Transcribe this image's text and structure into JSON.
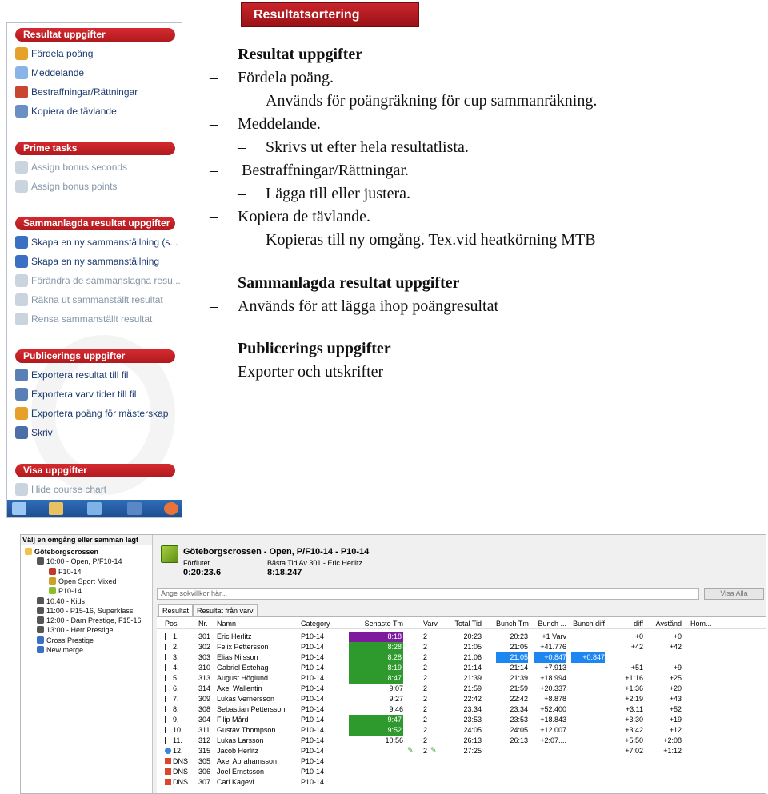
{
  "banner": {
    "title": "Resultatsortering"
  },
  "panel": {
    "sections": [
      {
        "title": "Resultat uppgifter",
        "items": [
          {
            "label": "Fördela poäng",
            "icon": "points-icon",
            "disabled": false
          },
          {
            "label": "Meddelande",
            "icon": "message-icon",
            "disabled": false
          },
          {
            "label": "Bestraffningar/Rättningar",
            "icon": "penalty-icon",
            "disabled": false
          },
          {
            "label": "Kopiera de tävlande",
            "icon": "copy-icon",
            "disabled": false
          }
        ]
      },
      {
        "title": "Prime tasks",
        "items": [
          {
            "label": "Assign bonus seconds",
            "icon": "bonus-seconds-icon",
            "disabled": true
          },
          {
            "label": "Assign bonus points",
            "icon": "bonus-points-icon",
            "disabled": true
          }
        ]
      },
      {
        "title": "Sammanlagda resultat uppgifter",
        "items": [
          {
            "label": "Skapa en ny sammanställning (s...",
            "icon": "new-summary-icon",
            "disabled": false
          },
          {
            "label": "Skapa en ny sammanställning",
            "icon": "new-summary-icon",
            "disabled": false
          },
          {
            "label": "Förändra de sammanslagna resu...",
            "icon": "edit-summary-icon",
            "disabled": true
          },
          {
            "label": "Räkna ut sammanställt resultat",
            "icon": "calculate-icon",
            "disabled": true
          },
          {
            "label": "Rensa sammanställt resultat",
            "icon": "clear-icon",
            "disabled": true
          }
        ]
      },
      {
        "title": "Publicerings uppgifter",
        "items": [
          {
            "label": "Exportera resultat till fil",
            "icon": "export-icon",
            "disabled": false
          },
          {
            "label": "Exportera varv tider till fil",
            "icon": "export-icon",
            "disabled": false
          },
          {
            "label": "Exportera poäng för mästerskap",
            "icon": "export-points-icon",
            "disabled": false
          },
          {
            "label": "Skriv",
            "icon": "print-icon",
            "disabled": false
          }
        ]
      },
      {
        "title": "Visa uppgifter",
        "items": [
          {
            "label": "Hide course chart",
            "icon": "chart-icon",
            "disabled": true
          }
        ]
      }
    ]
  },
  "notes": [
    {
      "text": "Resultat uppgifter",
      "kind": "heading",
      "dash": ""
    },
    {
      "text": "Fördela poäng.",
      "kind": "item",
      "dash": "–"
    },
    {
      "text": "Används för poängräkning för cup sammanräkning.",
      "kind": "sub",
      "dash": "–"
    },
    {
      "text": "Meddelande.",
      "kind": "item",
      "dash": "–"
    },
    {
      "text": "Skrivs ut efter hela resultatlista.",
      "kind": "sub",
      "dash": "–"
    },
    {
      "text": " Bestraffningar/Rättningar.",
      "kind": "item",
      "dash": "–"
    },
    {
      "text": "Lägga till eller justera.",
      "kind": "sub",
      "dash": "–"
    },
    {
      "text": "Kopiera de tävlande.",
      "kind": "item",
      "dash": "–"
    },
    {
      "text": "Kopieras till ny omgång. Tex.vid heatkörning MTB",
      "kind": "sub",
      "dash": "–"
    },
    {
      "text": "Sammanlagda resultat uppgifter",
      "kind": "heading",
      "dash": ""
    },
    {
      "text": "Används för att lägga ihop poängresultat",
      "kind": "item",
      "dash": "–"
    },
    {
      "text": "Publicerings uppgifter",
      "kind": "heading",
      "dash": ""
    },
    {
      "text": "Exporter och utskrifter",
      "kind": "item",
      "dash": "–"
    }
  ],
  "app": {
    "tree_title": "Välj en omgång eller samman lagt",
    "tree": [
      {
        "label": "Göteborgscrossen",
        "bold": true,
        "color": "#f0c24a"
      },
      {
        "label": "10:00 - Open, P/F10-14",
        "bold": false,
        "color": "#555555"
      },
      {
        "label": "F10-14",
        "bold": false,
        "color": "#c0392b"
      },
      {
        "label": "Open Sport Mixed",
        "bold": false,
        "color": "#c9a227"
      },
      {
        "label": "P10-14",
        "bold": false,
        "color": "#8bbf2a"
      },
      {
        "label": "10:40 - Kids",
        "bold": false,
        "color": "#555555"
      },
      {
        "label": "11:00 - P15-16, Superklass",
        "bold": false,
        "color": "#555555"
      },
      {
        "label": "12:00 - Dam Prestige, F15-16",
        "bold": false,
        "color": "#555555"
      },
      {
        "label": "13:00 - Herr Prestige",
        "bold": false,
        "color": "#555555"
      },
      {
        "label": "Cross Prestige",
        "bold": false,
        "color": "#3a6fc4"
      },
      {
        "label": "New merge",
        "bold": false,
        "color": "#3a6fc4"
      }
    ],
    "race_title": "Göteborgscrossen - Open, P/F10-14 - P10-14",
    "elapsed_label": "Förflutet",
    "elapsed_value": "0:20:23.6",
    "best_label": "Bästa Tid Av 301 - Eric Herlitz",
    "best_value": "8:18.247",
    "search_placeholder": "Ange sokvillkor här...",
    "show_all": "Visa Alla",
    "tabs": [
      "Resultat",
      "Resultat från varv"
    ],
    "columns": [
      "Pos",
      "Nr.",
      "Namn",
      "Category",
      "Senaste Tm",
      "Varv",
      "Total Tid",
      "Bunch Tm",
      "Bunch ...",
      "Bunch diff",
      "diff",
      "Avstånd",
      "Hom..."
    ],
    "rows": [
      {
        "pos": "1.",
        "nr": "301",
        "name": "Eric Herlitz",
        "cat": "P10-14",
        "last": "8:18",
        "laps": "2",
        "total": "20:23",
        "btm": "20:23",
        "bunch": "+1 Varv",
        "bdiff": "",
        "diff": "+0",
        "dist": "+0",
        "status": "flag",
        "lastColor": "#7d1a9e",
        "btmHighlight": false
      },
      {
        "pos": "2.",
        "nr": "302",
        "name": "Felix Pettersson",
        "cat": "P10-14",
        "last": "8:28",
        "laps": "2",
        "total": "21:05",
        "btm": "21:05",
        "bunch": "+41.776",
        "bdiff": "",
        "diff": "+42",
        "dist": "+42",
        "status": "flag",
        "lastColor": "#2e9a2e",
        "btmHighlight": false
      },
      {
        "pos": "3.",
        "nr": "303",
        "name": "Elias Nilsson",
        "cat": "P10-14",
        "last": "8:28",
        "laps": "2",
        "total": "21:06",
        "btm": "21:05",
        "bunch": "+0.847",
        "bdiff": "+0.847",
        "diff": "",
        "dist": "",
        "status": "flag",
        "lastColor": "#2e9a2e",
        "btmHighlight": true
      },
      {
        "pos": "4.",
        "nr": "310",
        "name": "Gabriel Estehag",
        "cat": "P10-14",
        "last": "8:19",
        "laps": "2",
        "total": "21:14",
        "btm": "21:14",
        "bunch": "+7.913",
        "bdiff": "",
        "diff": "+51",
        "dist": "+9",
        "status": "flag",
        "lastColor": "#2e9a2e",
        "btmHighlight": false
      },
      {
        "pos": "5.",
        "nr": "313",
        "name": "August Höglund",
        "cat": "P10-14",
        "last": "8:47",
        "laps": "2",
        "total": "21:39",
        "btm": "21:39",
        "bunch": "+18.994",
        "bdiff": "",
        "diff": "+1:16",
        "dist": "+25",
        "status": "flag",
        "lastColor": "#2e9a2e",
        "btmHighlight": false
      },
      {
        "pos": "6.",
        "nr": "314",
        "name": "Axel Wallentin",
        "cat": "P10-14",
        "last": "9:07",
        "laps": "2",
        "total": "21:59",
        "btm": "21:59",
        "bunch": "+20.337",
        "bdiff": "",
        "diff": "+1:36",
        "dist": "+20",
        "status": "flag",
        "lastColor": "",
        "btmHighlight": false
      },
      {
        "pos": "7.",
        "nr": "309",
        "name": "Lukas Vernersson",
        "cat": "P10-14",
        "last": "9:27",
        "laps": "2",
        "total": "22:42",
        "btm": "22:42",
        "bunch": "+8.878",
        "bdiff": "",
        "diff": "+2:19",
        "dist": "+43",
        "status": "flag",
        "lastColor": "",
        "btmHighlight": false
      },
      {
        "pos": "8.",
        "nr": "308",
        "name": "Sebastian Pettersson",
        "cat": "P10-14",
        "last": "9:46",
        "laps": "2",
        "total": "23:34",
        "btm": "23:34",
        "bunch": "+52.400",
        "bdiff": "",
        "diff": "+3:11",
        "dist": "+52",
        "status": "flag",
        "lastColor": "",
        "btmHighlight": false
      },
      {
        "pos": "9.",
        "nr": "304",
        "name": "Filip Mård",
        "cat": "P10-14",
        "last": "9:47",
        "laps": "2",
        "total": "23:53",
        "btm": "23:53",
        "bunch": "+18.843",
        "bdiff": "",
        "diff": "+3:30",
        "dist": "+19",
        "status": "flag",
        "lastColor": "#2e9a2e",
        "btmHighlight": false
      },
      {
        "pos": "10.",
        "nr": "311",
        "name": "Gustav Thompson",
        "cat": "P10-14",
        "last": "9:52",
        "laps": "2",
        "total": "24:05",
        "btm": "24:05",
        "bunch": "+12.007",
        "bdiff": "",
        "diff": "+3:42",
        "dist": "+12",
        "status": "flag",
        "lastColor": "#2e9a2e",
        "btmHighlight": false
      },
      {
        "pos": "11.",
        "nr": "312",
        "name": "Lukas Larsson",
        "cat": "P10-14",
        "last": "10:56",
        "laps": "2",
        "total": "26:13",
        "btm": "26:13",
        "bunch": "+2:07....",
        "bdiff": "",
        "diff": "+5:50",
        "dist": "+2:08",
        "status": "flag",
        "lastColor": "",
        "btmHighlight": false
      },
      {
        "pos": "12.",
        "nr": "315",
        "name": "Jacob Herlitz",
        "cat": "P10-14",
        "last": "",
        "laps": "2",
        "total": "27:25",
        "btm": "",
        "bunch": "",
        "bdiff": "",
        "diff": "+7:02",
        "dist": "+1:12",
        "status": "dot",
        "lastColor": "",
        "btmHighlight": false
      },
      {
        "pos": "DNS",
        "nr": "305",
        "name": "Axel Abrahamsson",
        "cat": "P10-14",
        "last": "",
        "laps": "",
        "total": "",
        "btm": "",
        "bunch": "",
        "bdiff": "",
        "diff": "",
        "dist": "",
        "status": "dns",
        "lastColor": "",
        "btmHighlight": false
      },
      {
        "pos": "DNS",
        "nr": "306",
        "name": "Joel Ernstsson",
        "cat": "P10-14",
        "last": "",
        "laps": "",
        "total": "",
        "btm": "",
        "bunch": "",
        "bdiff": "",
        "diff": "",
        "dist": "",
        "status": "dns",
        "lastColor": "",
        "btmHighlight": false
      },
      {
        "pos": "DNS",
        "nr": "307",
        "name": "Carl Kagevi",
        "cat": "P10-14",
        "last": "",
        "laps": "",
        "total": "",
        "btm": "",
        "bunch": "",
        "bdiff": "",
        "diff": "",
        "dist": "",
        "status": "dns",
        "lastColor": "",
        "btmHighlight": false
      }
    ]
  }
}
